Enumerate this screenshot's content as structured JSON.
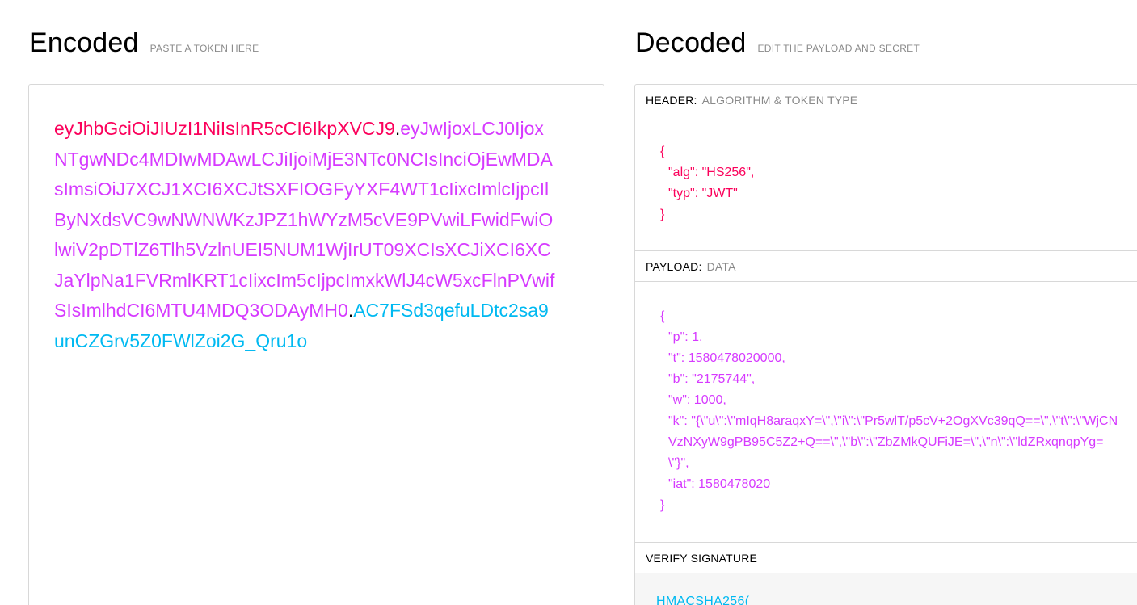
{
  "encoded": {
    "title": "Encoded",
    "subtitle": "PASTE A TOKEN HERE",
    "token_header": "eyJhbGciOiJIUzI1NiIsInR5cCI6IkpXVCJ9",
    "token_payload": "eyJwIjoxLCJ0IjoxNTgwNDc4MDIwMDAwLCJiIjoiMjE3NTc0NCIsInciOjEwMDAsImsiOiJ7XCJ1XCI6XCJtSXFIOGFyYXF4WT1cIixcImlcIjpcIlByNXdsVC9wNWNWKzJPZ1hWYzM5cVE9PVwiLFwidFwiOlwiV2pDTlZ6Tlh5VzlnUEI5NUM1WjIrUT09XCIsXCJiXCI6XCJaYlpNa1FVRmlKRT1cIixcIm5cIjpcImxkWlJ4cW5xcFlnPVwifSIsImlhdCI6MTU4MDQ3ODAyMH0",
    "token_signature": "AC7FSd3qefuLDtc2sa9unCZGrv5Z0FWlZoi2G_Qru1o",
    "dot": "."
  },
  "decoded": {
    "title": "Decoded",
    "subtitle": "EDIT THE PAYLOAD AND SECRET",
    "header_section": {
      "name": "HEADER:",
      "desc": "ALGORITHM & TOKEN TYPE",
      "open": "{",
      "lines": [
        "\"alg\": \"HS256\",",
        "\"typ\": \"JWT\""
      ],
      "close": "}"
    },
    "payload_section": {
      "name": "PAYLOAD:",
      "desc": "DATA",
      "open": "{",
      "lines": [
        "\"p\": 1,",
        "\"t\": 1580478020000,",
        "\"b\": \"2175744\",",
        "\"w\": 1000,",
        "\"k\": \"{\\\"u\\\":\\\"mIqH8araqxY=\\\",\\\"i\\\":\\\"Pr5wlT/p5cV+2OgXVc39qQ==\\\",\\\"t\\\":\\\"WjCNVzNXyW9gPB95C5Z2+Q==\\\",\\\"b\\\":\\\"ZbZMkQUFiJE=\\\",\\\"n\\\":\\\"ldZRxqnqpYg=\\\"}\",",
        "\"iat\": 1580478020"
      ],
      "close": "}"
    },
    "signature_section": {
      "name": "VERIFY SIGNATURE",
      "algorithm": "HMACSHA256("
    }
  },
  "colors": {
    "header": "#fb015b",
    "payload": "#d63aff",
    "signature": "#00b9f1"
  }
}
